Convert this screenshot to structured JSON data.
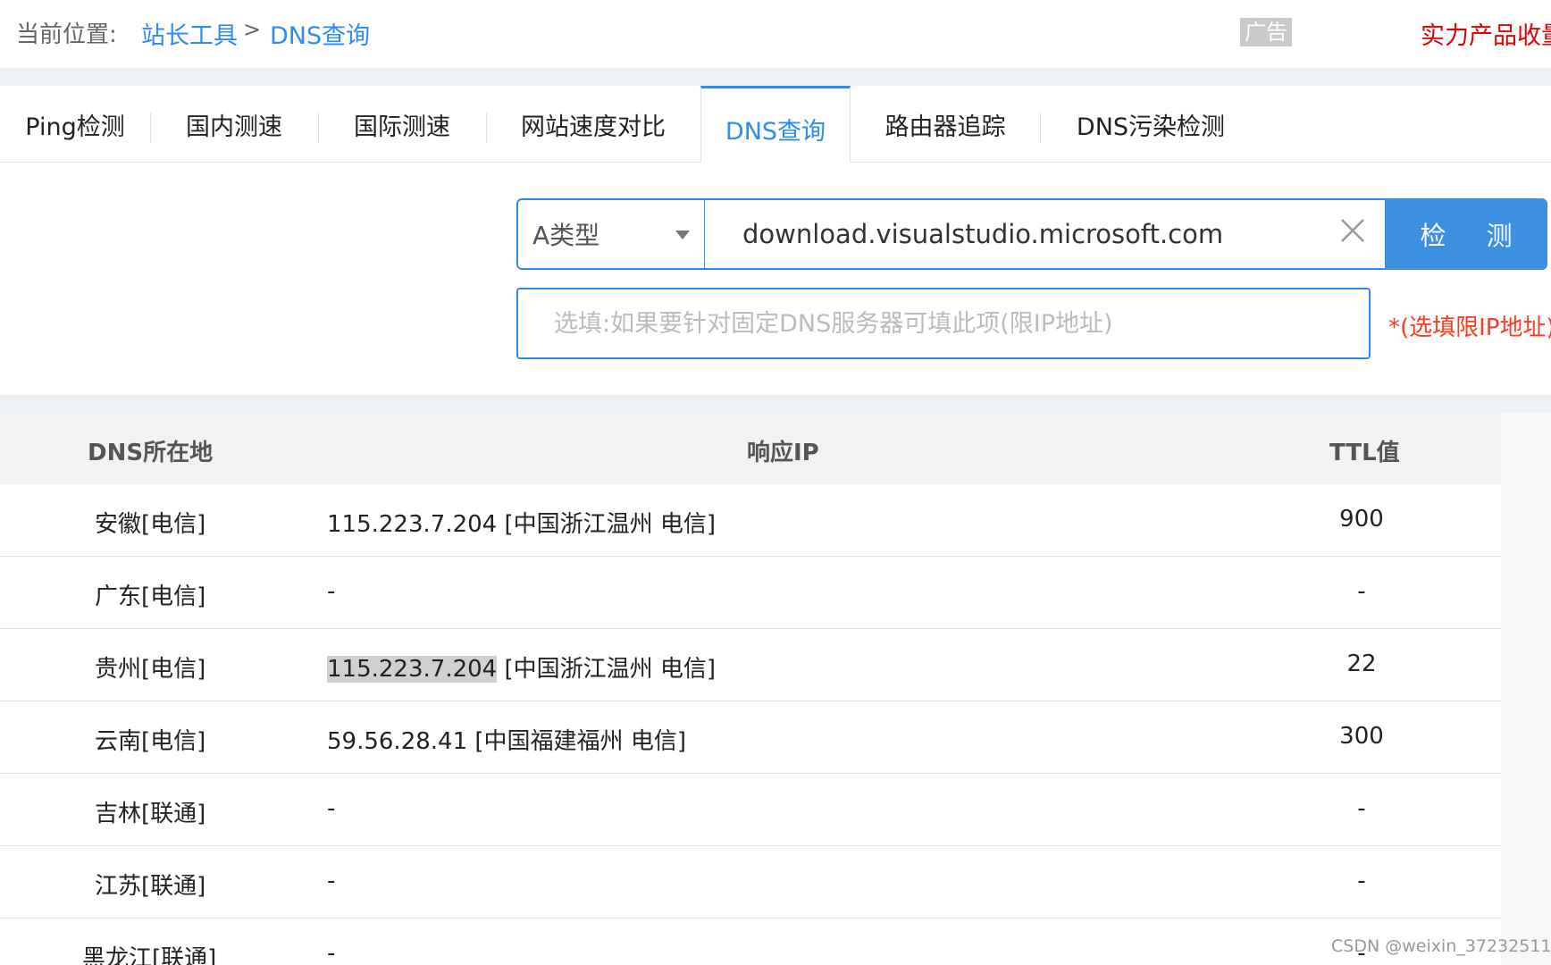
{
  "breadcrumb": {
    "label": "当前位置:",
    "items": [
      "站长工具",
      "DNS查询"
    ],
    "separator": ">"
  },
  "ad": {
    "badge": "广告",
    "text": "实力产品收量"
  },
  "tabs": [
    {
      "label": "Ping检测"
    },
    {
      "label": "国内测速"
    },
    {
      "label": "国际测速"
    },
    {
      "label": "网站速度对比"
    },
    {
      "label": "DNS查询",
      "active": true
    },
    {
      "label": "路由器追踪"
    },
    {
      "label": "DNS污染检测"
    }
  ],
  "form": {
    "record_type": "A类型",
    "domain_value": "download.visualstudio.microsoft.com",
    "detect_label": "检 测",
    "dns_placeholder": "选填:如果要针对固定DNS服务器可填此项(限IP地址)",
    "dns_hint": "*(选填限IP地址)"
  },
  "table": {
    "headers": {
      "location": "DNS所在地",
      "ip": "响应IP",
      "ttl": "TTL值"
    },
    "rows": [
      {
        "location": "安徽[电信]",
        "ip": "115.223.7.204",
        "geo": " [中国浙江温州 电信]",
        "ttl": "900",
        "highlight": false
      },
      {
        "location": "广东[电信]",
        "ip": "-",
        "geo": "",
        "ttl": "-",
        "highlight": false
      },
      {
        "location": "贵州[电信]",
        "ip": "115.223.7.204",
        "geo": " [中国浙江温州 电信]",
        "ttl": "22",
        "highlight": true
      },
      {
        "location": "云南[电信]",
        "ip": "59.56.28.41",
        "geo": " [中国福建福州 电信]",
        "ttl": "300",
        "highlight": false
      },
      {
        "location": "吉林[联通]",
        "ip": "-",
        "geo": "",
        "ttl": "-",
        "highlight": false
      },
      {
        "location": "江苏[联通]",
        "ip": "-",
        "geo": "",
        "ttl": "-",
        "highlight": false
      },
      {
        "location": "黑龙江[联通]",
        "ip": "-",
        "geo": "",
        "ttl": "-",
        "highlight": false
      }
    ]
  },
  "watermark": "CSDN @weixin_37232511",
  "colors": {
    "accent": "#2d8cf0",
    "button": "#3d8fe0",
    "ad_text": "#e60000",
    "hint": "#ff3b1f"
  }
}
